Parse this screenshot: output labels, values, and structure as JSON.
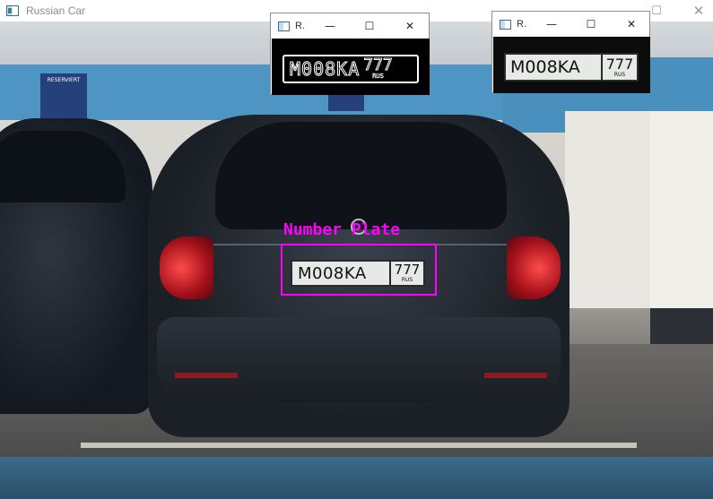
{
  "main_window": {
    "title": "Russian Car",
    "controls": {
      "minimize": "—",
      "maximize": "☐",
      "close": "✕"
    }
  },
  "scene": {
    "sign_text": "RESERVIERT",
    "detection_label": "Number Plate",
    "detection_color": "#ff00ff",
    "plate": {
      "number": "M008KA",
      "region": "777",
      "country": "RUS"
    }
  },
  "popups": [
    {
      "title": "R.",
      "controls": {
        "minimize": "—",
        "maximize": "☐",
        "close": "✕"
      },
      "content": "edge-map",
      "plate": {
        "number": "M008KA",
        "region": "777",
        "country": "RUS"
      }
    },
    {
      "title": "R.",
      "controls": {
        "minimize": "—",
        "maximize": "☐",
        "close": "✕"
      },
      "content": "cropped-plate",
      "plate": {
        "number": "M008KA",
        "region": "777",
        "country": "RUS"
      }
    }
  ]
}
